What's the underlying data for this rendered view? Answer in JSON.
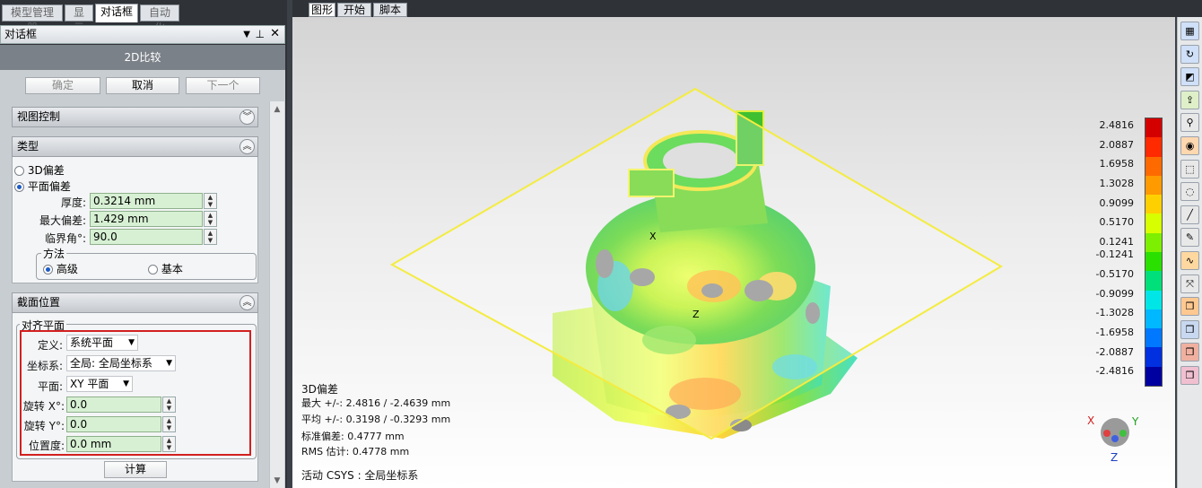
{
  "top_tabs": [
    "模型管理器",
    "显示",
    "对话框",
    "自动化"
  ],
  "dialog": {
    "header": "对话框",
    "pin": "▾ 𝟭",
    "title": "2D比较",
    "buttons": {
      "ok": "确定",
      "cancel": "取消",
      "next": "下一个"
    }
  },
  "sections": {
    "view_control": "视图控制",
    "type": "类型",
    "section_pos": "截面位置"
  },
  "type": {
    "opt3d": "3D偏差",
    "optplane": "平面偏差",
    "thickness_label": "厚度:",
    "thickness": "0.3214 mm",
    "maxdev_label": "最大偏差:",
    "maxdev": "1.429 mm",
    "crit_label": "临界角°:",
    "crit": "90.0",
    "method_label": "方法",
    "adv": "高级",
    "basic": "基本"
  },
  "align": {
    "group": "对齐平面",
    "def_label": "定义:",
    "def": "系统平面",
    "cs_label": "坐标系:",
    "cs": "全局: 全局坐标系",
    "plane_label": "平面:",
    "plane": "XY 平面",
    "rx_label": "旋转 X°:",
    "rx": "0.0",
    "ry_label": "旋转 Y°:",
    "ry": "0.0",
    "pos_label": "位置度:",
    "pos": "0.0 mm",
    "calc": "计算"
  },
  "view_tabs": [
    "图形",
    "开始",
    "脚本"
  ],
  "legend": {
    "labels": [
      "2.4816",
      "2.0887",
      "1.6958",
      "1.3028",
      "0.9099",
      "0.5170",
      "0.1241",
      "-0.1241",
      "-0.5170",
      "-0.9099",
      "-1.3028",
      "-1.6958",
      "-2.0887",
      "-2.4816"
    ],
    "colors": [
      "#d40000",
      "#ff2a00",
      "#ff6a00",
      "#ff9a00",
      "#ffd000",
      "#d8ff00",
      "#7cf000",
      "#2ae000",
      "#00e07a",
      "#00e6e6",
      "#00b8ff",
      "#0078ff",
      "#0030e0",
      "#0000a0"
    ]
  },
  "stats": {
    "title": "3D偏差",
    "max": "最大 +/-: 2.4816 / -2.4639 mm",
    "avg": "平均 +/-: 0.3198 / -0.3293 mm",
    "std": "标准偏差: 0.4777 mm",
    "rms": "RMS 估计:  0.4778 mm",
    "csys": "活动 CSYS : 全局坐标系"
  },
  "axes": {
    "x": "X",
    "y": "Y",
    "z": "Z",
    "model_x": "X",
    "model_z": "Z"
  },
  "colors": {
    "accent_red": "#d22020",
    "field_green": "#d7f0d3"
  },
  "icons": [
    "view-cube-icon",
    "rotate-icon",
    "plane-icon",
    "export-icon",
    "zoom-icon",
    "sphere-icon",
    "select-box-icon",
    "lasso-icon",
    "line-icon",
    "brush-icon",
    "shape-icon",
    "transform-icon",
    "cube-orange-icon",
    "cube-blue-icon",
    "cube-red-icon",
    "cube-pink-icon"
  ]
}
